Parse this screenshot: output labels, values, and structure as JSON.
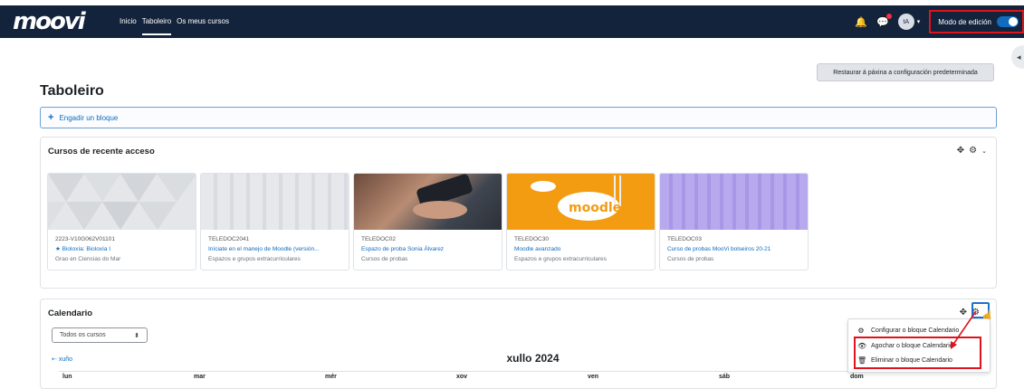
{
  "navbar": {
    "logo_text": "moovi",
    "links": [
      "Inicio",
      "Taboleiro",
      "Os meus cursos"
    ],
    "active_link": "Taboleiro",
    "avatar_initials": "tA",
    "edit_mode_label": "Modo de edición",
    "edit_mode_on": true
  },
  "reset_button_label": "Restaurar á páxina a configuración predeterminada",
  "page_title": "Taboleiro",
  "add_block_label": "Engadir un bloque",
  "recent": {
    "title": "Cursos de recente acceso",
    "courses": [
      {
        "code": "2223-V10G062V01101",
        "name": "Bioloxía: Bioloxía I",
        "category": "Grao en Ciencias do Mar",
        "starred": true,
        "image": "grey-triangles"
      },
      {
        "code": "TELEDOC2041",
        "name": "Iníciate en el manejo de Moodle (versión...",
        "category": "Espazos e grupos extracurriculares",
        "starred": false,
        "image": "grey-plaid"
      },
      {
        "code": "TELEDOC02",
        "name": "Espazo de proba Sonia Álvarez",
        "category": "Cursos de probas",
        "starred": false,
        "image": "phone-photo"
      },
      {
        "code": "TELEDOC30",
        "name": "Moodle avanzado",
        "category": "Espazos e grupos extracurriculares",
        "starred": false,
        "image": "moodle-logo"
      },
      {
        "code": "TELEDOC03",
        "name": "Curso de probas MooVi bolseiros 20-21",
        "category": "Cursos de probas",
        "starred": false,
        "image": "purple-plaid"
      }
    ]
  },
  "calendar": {
    "title": "Calendario",
    "filter_value": "Todos os cursos",
    "prev_month": "xuño",
    "month": "xullo 2024",
    "weekdays": [
      "lun",
      "mar",
      "mér",
      "xov",
      "ven",
      "sáb",
      "dom"
    ]
  },
  "block_menu": {
    "items": [
      {
        "label": "Configurar o bloque Calendario",
        "icon": "gear-icon"
      },
      {
        "label": "Agochar o bloque Calendario",
        "icon": "eye-icon"
      },
      {
        "label": "Eliminar o bloque Calendario",
        "icon": "trash-icon"
      }
    ]
  },
  "colors": {
    "navbar": "#14233c",
    "accent": "#0f6cbf",
    "highlight": "#e0121b"
  }
}
